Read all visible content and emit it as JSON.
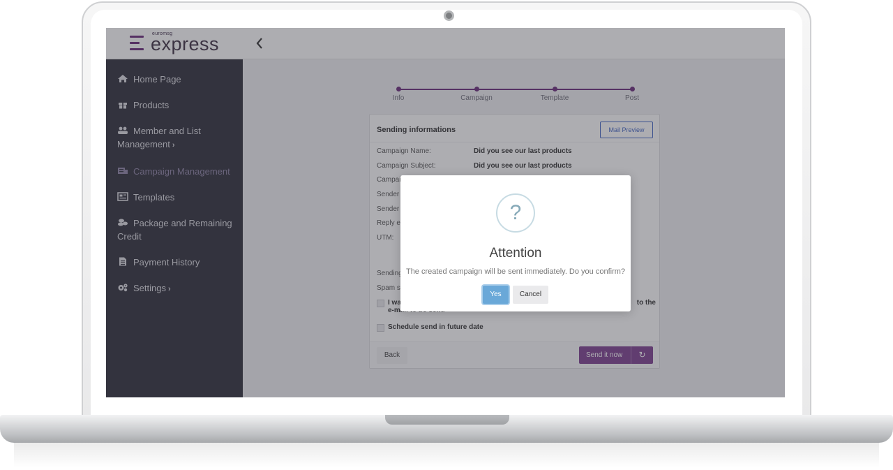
{
  "brand": {
    "small": "euromsg",
    "big": "express",
    "accent_color": "#6a2a7a"
  },
  "sidebar": {
    "items": [
      {
        "label": "Home Page",
        "icon": "home-icon",
        "chevron": ""
      },
      {
        "label": "Products",
        "icon": "gift-icon",
        "chevron": ""
      },
      {
        "label": "Member and List Management",
        "icon": "users-icon",
        "chevron": "›"
      },
      {
        "label": "Campaign Management",
        "icon": "campaign-icon",
        "chevron": "",
        "active": true
      },
      {
        "label": "Templates",
        "icon": "template-icon",
        "chevron": ""
      },
      {
        "label": "Package and Remaining Credit",
        "icon": "coins-icon",
        "chevron": ""
      },
      {
        "label": "Payment History",
        "icon": "document-icon",
        "chevron": ""
      },
      {
        "label": "Settings",
        "icon": "gears-icon",
        "chevron": "›"
      }
    ]
  },
  "steps": [
    "Info",
    "Campaign",
    "Template",
    "Post"
  ],
  "card": {
    "title": "Sending informations",
    "preview_label": "Mail Preview",
    "rows": [
      {
        "key": "Campaign Name:",
        "value": "Did you see our last products"
      },
      {
        "key": "Campaign Subject:",
        "value": "Did you see our last products"
      },
      {
        "key": "Campaign",
        "value": ""
      },
      {
        "key": "Sender",
        "value": ""
      },
      {
        "key": "Sender",
        "value": ""
      },
      {
        "key": "Reply e-",
        "value": ""
      },
      {
        "key": "UTM:",
        "value": ""
      }
    ],
    "sending_label": "Sending",
    "spam_label": "Spam sc",
    "check1_start": "I wa",
    "check1_end": "to the",
    "check1_line2": "e-mail to be sent.",
    "check2": "Schedule send in future date",
    "back_label": "Back",
    "send_label": "Send it now",
    "send_color": "#7d3e90"
  },
  "modal": {
    "icon": "question-icon",
    "glyph": "?",
    "title": "Attention",
    "message": "The created campaign will be sent immediately. Do you confirm?",
    "yes_label": "Yes",
    "cancel_label": "Cancel",
    "yes_color": "#6aa8d8"
  }
}
